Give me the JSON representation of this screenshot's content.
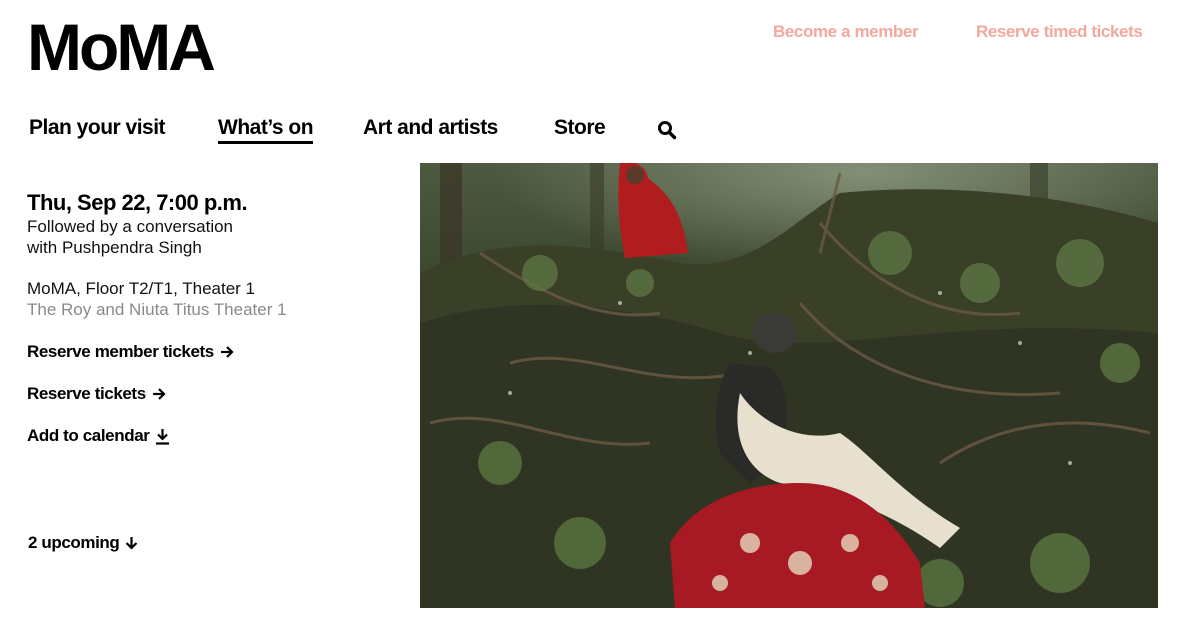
{
  "header": {
    "logo": "MoMA",
    "utility_links": {
      "become_member": "Become a member",
      "reserve_timed": "Reserve timed tickets"
    },
    "link_color": "#f2a89c"
  },
  "nav": {
    "items": [
      {
        "label": "Plan your visit"
      },
      {
        "label": "What’s on",
        "active": true
      },
      {
        "label": "Art and artists"
      },
      {
        "label": "Store"
      }
    ],
    "search_icon": "search-icon"
  },
  "event": {
    "date": "Thu, Sep 22, 7:00 p.m.",
    "followup_line1": "Followed by a conversation",
    "followup_line2": "with Pushpendra Singh",
    "venue": "MoMA, Floor T2/T1, Theater 1",
    "venue_sub": "The Roy and Niuta Titus Theater 1"
  },
  "actions": {
    "reserve_member": "Reserve member tickets",
    "reserve_tickets": "Reserve tickets",
    "add_calendar": "Add to calendar",
    "upcoming": "2 upcoming"
  },
  "icons": {
    "arrow_right": "arrow-right-icon",
    "download": "download-icon",
    "arrow_down": "arrow-down-icon"
  }
}
